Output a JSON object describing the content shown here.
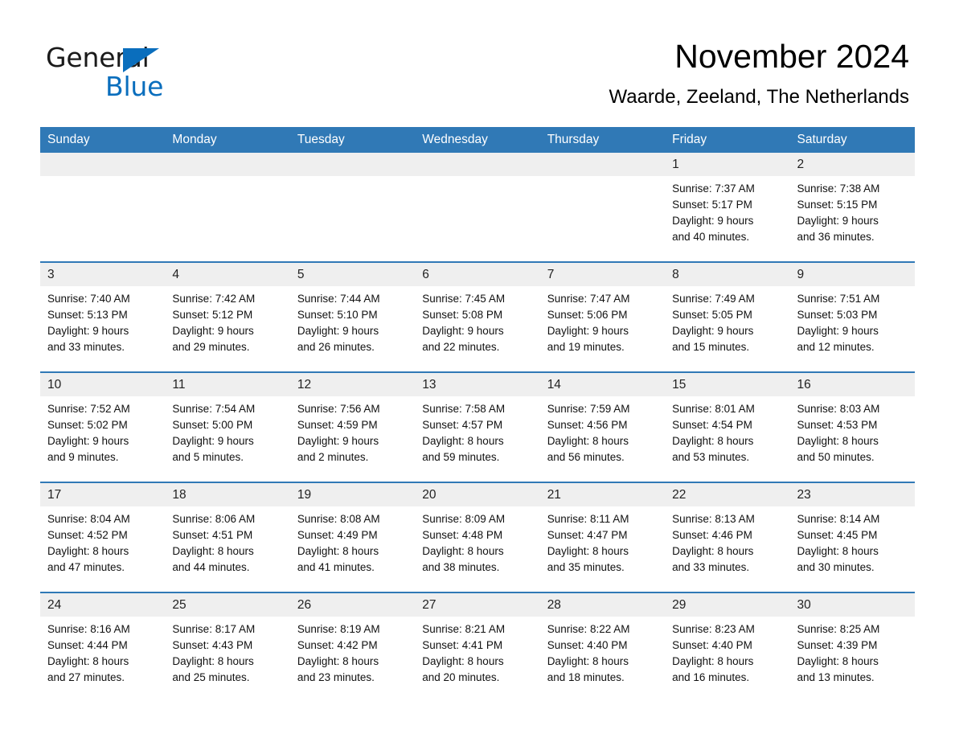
{
  "brand": {
    "name_part1": "General",
    "name_part2": "Blue",
    "accent_color": "#0a6ebd"
  },
  "header": {
    "month_title": "November 2024",
    "location": "Waarde, Zeeland, The Netherlands",
    "header_bg_color": "#3079b6",
    "daynum_bg_color": "#efefef"
  },
  "weekday_headers": [
    {
      "label": "Sunday"
    },
    {
      "label": "Monday"
    },
    {
      "label": "Tuesday"
    },
    {
      "label": "Wednesday"
    },
    {
      "label": "Thursday"
    },
    {
      "label": "Friday"
    },
    {
      "label": "Saturday"
    }
  ],
  "weeks": [
    [
      {
        "day": "",
        "lines": []
      },
      {
        "day": "",
        "lines": []
      },
      {
        "day": "",
        "lines": []
      },
      {
        "day": "",
        "lines": []
      },
      {
        "day": "",
        "lines": []
      },
      {
        "day": "1",
        "lines": [
          "Sunrise: 7:37 AM",
          "Sunset: 5:17 PM",
          "Daylight: 9 hours",
          "and 40 minutes."
        ]
      },
      {
        "day": "2",
        "lines": [
          "Sunrise: 7:38 AM",
          "Sunset: 5:15 PM",
          "Daylight: 9 hours",
          "and 36 minutes."
        ]
      }
    ],
    [
      {
        "day": "3",
        "lines": [
          "Sunrise: 7:40 AM",
          "Sunset: 5:13 PM",
          "Daylight: 9 hours",
          "and 33 minutes."
        ]
      },
      {
        "day": "4",
        "lines": [
          "Sunrise: 7:42 AM",
          "Sunset: 5:12 PM",
          "Daylight: 9 hours",
          "and 29 minutes."
        ]
      },
      {
        "day": "5",
        "lines": [
          "Sunrise: 7:44 AM",
          "Sunset: 5:10 PM",
          "Daylight: 9 hours",
          "and 26 minutes."
        ]
      },
      {
        "day": "6",
        "lines": [
          "Sunrise: 7:45 AM",
          "Sunset: 5:08 PM",
          "Daylight: 9 hours",
          "and 22 minutes."
        ]
      },
      {
        "day": "7",
        "lines": [
          "Sunrise: 7:47 AM",
          "Sunset: 5:06 PM",
          "Daylight: 9 hours",
          "and 19 minutes."
        ]
      },
      {
        "day": "8",
        "lines": [
          "Sunrise: 7:49 AM",
          "Sunset: 5:05 PM",
          "Daylight: 9 hours",
          "and 15 minutes."
        ]
      },
      {
        "day": "9",
        "lines": [
          "Sunrise: 7:51 AM",
          "Sunset: 5:03 PM",
          "Daylight: 9 hours",
          "and 12 minutes."
        ]
      }
    ],
    [
      {
        "day": "10",
        "lines": [
          "Sunrise: 7:52 AM",
          "Sunset: 5:02 PM",
          "Daylight: 9 hours",
          "and 9 minutes."
        ]
      },
      {
        "day": "11",
        "lines": [
          "Sunrise: 7:54 AM",
          "Sunset: 5:00 PM",
          "Daylight: 9 hours",
          "and 5 minutes."
        ]
      },
      {
        "day": "12",
        "lines": [
          "Sunrise: 7:56 AM",
          "Sunset: 4:59 PM",
          "Daylight: 9 hours",
          "and 2 minutes."
        ]
      },
      {
        "day": "13",
        "lines": [
          "Sunrise: 7:58 AM",
          "Sunset: 4:57 PM",
          "Daylight: 8 hours",
          "and 59 minutes."
        ]
      },
      {
        "day": "14",
        "lines": [
          "Sunrise: 7:59 AM",
          "Sunset: 4:56 PM",
          "Daylight: 8 hours",
          "and 56 minutes."
        ]
      },
      {
        "day": "15",
        "lines": [
          "Sunrise: 8:01 AM",
          "Sunset: 4:54 PM",
          "Daylight: 8 hours",
          "and 53 minutes."
        ]
      },
      {
        "day": "16",
        "lines": [
          "Sunrise: 8:03 AM",
          "Sunset: 4:53 PM",
          "Daylight: 8 hours",
          "and 50 minutes."
        ]
      }
    ],
    [
      {
        "day": "17",
        "lines": [
          "Sunrise: 8:04 AM",
          "Sunset: 4:52 PM",
          "Daylight: 8 hours",
          "and 47 minutes."
        ]
      },
      {
        "day": "18",
        "lines": [
          "Sunrise: 8:06 AM",
          "Sunset: 4:51 PM",
          "Daylight: 8 hours",
          "and 44 minutes."
        ]
      },
      {
        "day": "19",
        "lines": [
          "Sunrise: 8:08 AM",
          "Sunset: 4:49 PM",
          "Daylight: 8 hours",
          "and 41 minutes."
        ]
      },
      {
        "day": "20",
        "lines": [
          "Sunrise: 8:09 AM",
          "Sunset: 4:48 PM",
          "Daylight: 8 hours",
          "and 38 minutes."
        ]
      },
      {
        "day": "21",
        "lines": [
          "Sunrise: 8:11 AM",
          "Sunset: 4:47 PM",
          "Daylight: 8 hours",
          "and 35 minutes."
        ]
      },
      {
        "day": "22",
        "lines": [
          "Sunrise: 8:13 AM",
          "Sunset: 4:46 PM",
          "Daylight: 8 hours",
          "and 33 minutes."
        ]
      },
      {
        "day": "23",
        "lines": [
          "Sunrise: 8:14 AM",
          "Sunset: 4:45 PM",
          "Daylight: 8 hours",
          "and 30 minutes."
        ]
      }
    ],
    [
      {
        "day": "24",
        "lines": [
          "Sunrise: 8:16 AM",
          "Sunset: 4:44 PM",
          "Daylight: 8 hours",
          "and 27 minutes."
        ]
      },
      {
        "day": "25",
        "lines": [
          "Sunrise: 8:17 AM",
          "Sunset: 4:43 PM",
          "Daylight: 8 hours",
          "and 25 minutes."
        ]
      },
      {
        "day": "26",
        "lines": [
          "Sunrise: 8:19 AM",
          "Sunset: 4:42 PM",
          "Daylight: 8 hours",
          "and 23 minutes."
        ]
      },
      {
        "day": "27",
        "lines": [
          "Sunrise: 8:21 AM",
          "Sunset: 4:41 PM",
          "Daylight: 8 hours",
          "and 20 minutes."
        ]
      },
      {
        "day": "28",
        "lines": [
          "Sunrise: 8:22 AM",
          "Sunset: 4:40 PM",
          "Daylight: 8 hours",
          "and 18 minutes."
        ]
      },
      {
        "day": "29",
        "lines": [
          "Sunrise: 8:23 AM",
          "Sunset: 4:40 PM",
          "Daylight: 8 hours",
          "and 16 minutes."
        ]
      },
      {
        "day": "30",
        "lines": [
          "Sunrise: 8:25 AM",
          "Sunset: 4:39 PM",
          "Daylight: 8 hours",
          "and 13 minutes."
        ]
      }
    ]
  ]
}
